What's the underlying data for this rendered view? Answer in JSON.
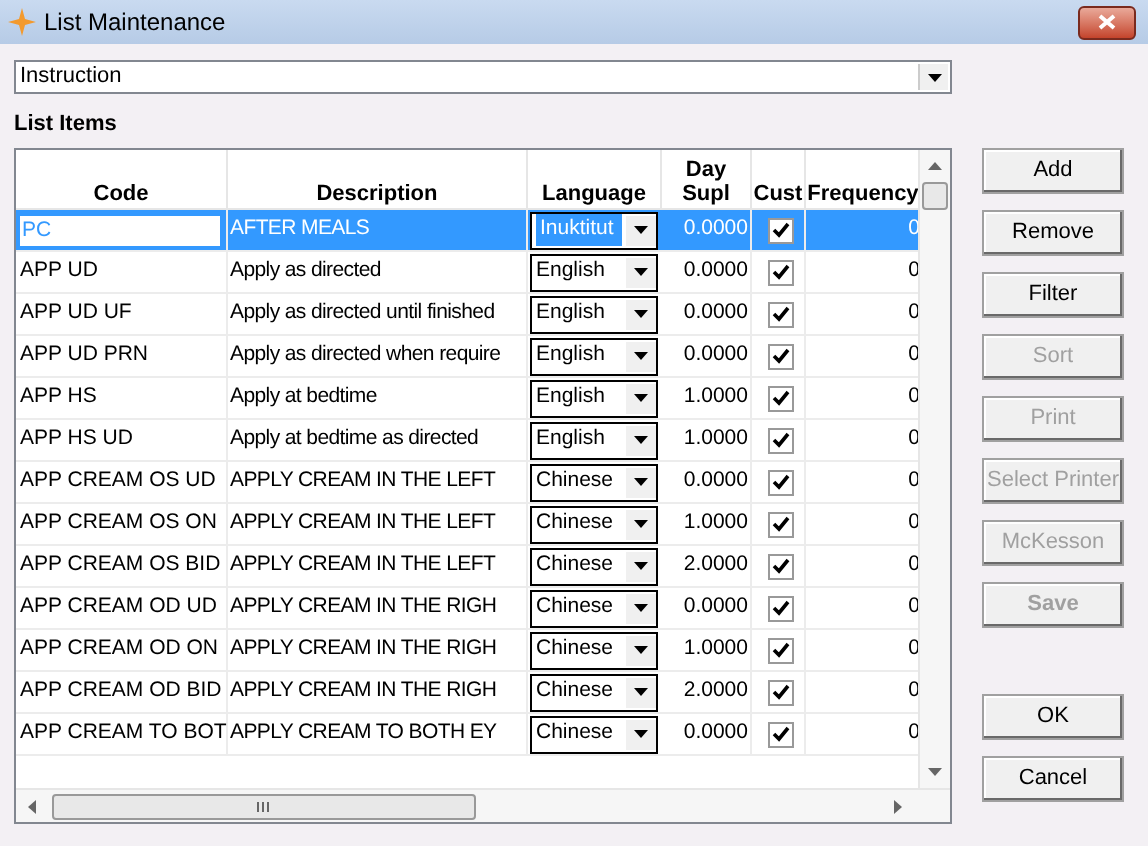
{
  "window": {
    "title": "List Maintenance"
  },
  "list_selector": {
    "value": "Instruction"
  },
  "section_label": "List Items",
  "table": {
    "columns": [
      "Code",
      "Description",
      "Language",
      "Day Supl",
      "Cust",
      "Frequency"
    ],
    "rows": [
      {
        "code": "PC",
        "description": "AFTER MEALS",
        "language": "Inuktitut",
        "day_supl": "0.0000",
        "cust": true,
        "frequency": "0",
        "selected": true
      },
      {
        "code": "APP UD",
        "description": "Apply as directed",
        "language": "English",
        "day_supl": "0.0000",
        "cust": true,
        "frequency": "0",
        "selected": false
      },
      {
        "code": "APP UD UF",
        "description": "Apply as directed until finished",
        "language": "English",
        "day_supl": "0.0000",
        "cust": true,
        "frequency": "0",
        "selected": false
      },
      {
        "code": "APP UD PRN",
        "description": "Apply as directed when require",
        "language": "English",
        "day_supl": "0.0000",
        "cust": true,
        "frequency": "0",
        "selected": false
      },
      {
        "code": "APP HS",
        "description": "Apply at bedtime",
        "language": "English",
        "day_supl": "1.0000",
        "cust": true,
        "frequency": "0",
        "selected": false
      },
      {
        "code": "APP HS UD",
        "description": "Apply at bedtime as directed",
        "language": "English",
        "day_supl": "1.0000",
        "cust": true,
        "frequency": "0",
        "selected": false
      },
      {
        "code": "APP CREAM OS UD",
        "description": "APPLY CREAM IN THE LEFT",
        "language": "Chinese",
        "day_supl": "0.0000",
        "cust": true,
        "frequency": "0",
        "selected": false
      },
      {
        "code": "APP CREAM OS ON",
        "description": "APPLY CREAM IN THE LEFT",
        "language": "Chinese",
        "day_supl": "1.0000",
        "cust": true,
        "frequency": "0",
        "selected": false
      },
      {
        "code": "APP CREAM OS BID",
        "description": "APPLY CREAM IN THE LEFT",
        "language": "Chinese",
        "day_supl": "2.0000",
        "cust": true,
        "frequency": "0",
        "selected": false
      },
      {
        "code": "APP CREAM OD UD",
        "description": "APPLY CREAM IN THE RIGH",
        "language": "Chinese",
        "day_supl": "0.0000",
        "cust": true,
        "frequency": "0",
        "selected": false
      },
      {
        "code": "APP CREAM OD ON",
        "description": "APPLY CREAM IN THE RIGH",
        "language": "Chinese",
        "day_supl": "1.0000",
        "cust": true,
        "frequency": "0",
        "selected": false
      },
      {
        "code": "APP CREAM OD BID",
        "description": "APPLY CREAM IN THE RIGH",
        "language": "Chinese",
        "day_supl": "2.0000",
        "cust": true,
        "frequency": "0",
        "selected": false
      },
      {
        "code": "APP CREAM TO BOT",
        "description": "APPLY CREAM TO BOTH EY",
        "language": "Chinese",
        "day_supl": "0.0000",
        "cust": true,
        "frequency": "0",
        "selected": false
      }
    ]
  },
  "buttons": [
    {
      "label": "Add",
      "disabled": false
    },
    {
      "label": "Remove",
      "disabled": false
    },
    {
      "label": "Filter",
      "disabled": false
    },
    {
      "label": "Sort",
      "disabled": true
    },
    {
      "label": "Print",
      "disabled": true
    },
    {
      "label": "Select Printer",
      "disabled": true
    },
    {
      "label": "McKesson",
      "disabled": true
    },
    {
      "label": "Save",
      "disabled": true
    }
  ],
  "dialog_buttons": [
    {
      "label": "OK",
      "disabled": false
    },
    {
      "label": "Cancel",
      "disabled": false
    }
  ]
}
